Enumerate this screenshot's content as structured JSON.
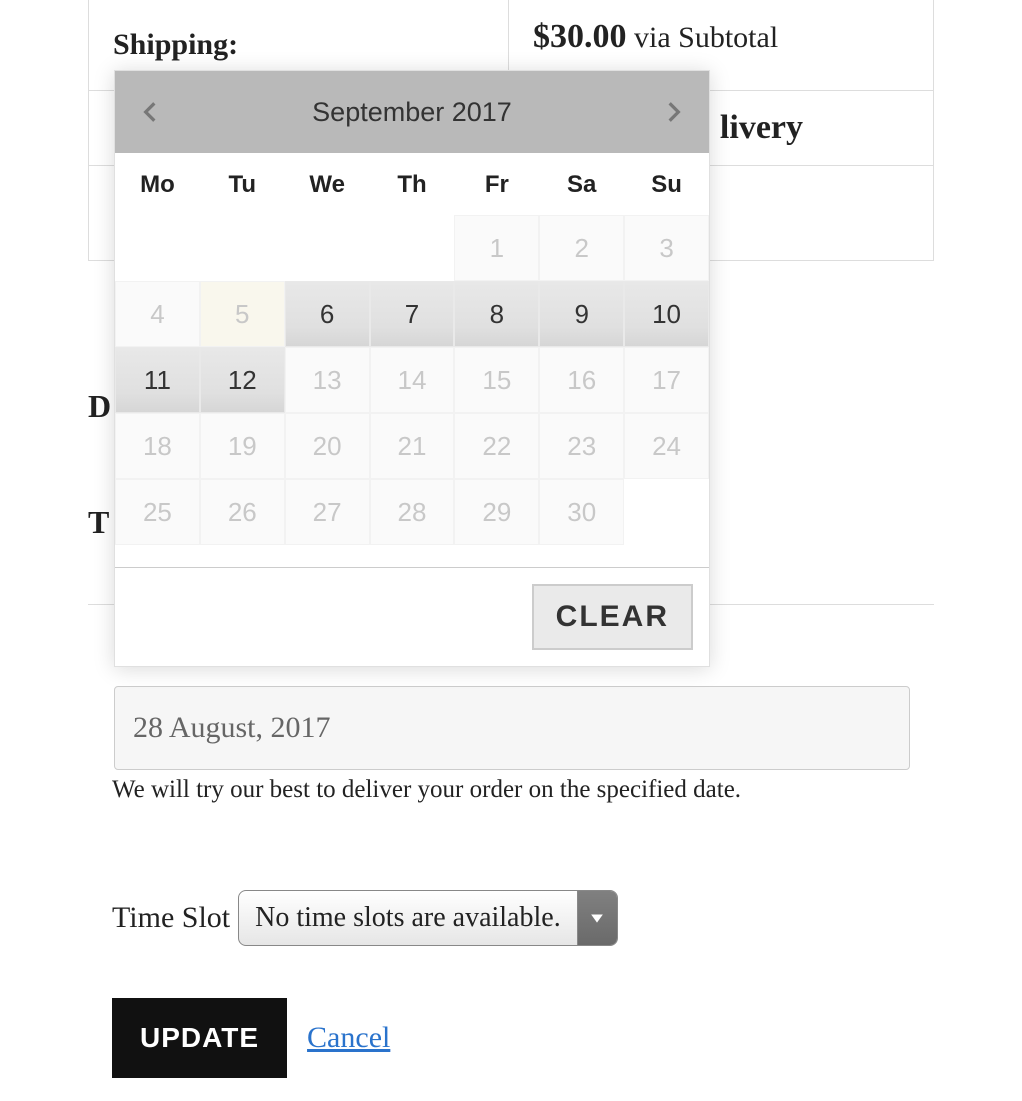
{
  "background": {
    "shipping_label": "Shipping:",
    "price": "$30.00",
    "via": "via Subtotal",
    "right2": "livery",
    "d_label": "D",
    "t_label": "T"
  },
  "datepicker": {
    "title": "September 2017",
    "weekdays": [
      "Mo",
      "Tu",
      "We",
      "Th",
      "Fr",
      "Sa",
      "Su"
    ],
    "weeks": [
      [
        {
          "d": "",
          "e": false
        },
        {
          "d": "",
          "e": false
        },
        {
          "d": "",
          "e": false
        },
        {
          "d": "",
          "e": false
        },
        {
          "d": "1",
          "e": false
        },
        {
          "d": "2",
          "e": false
        },
        {
          "d": "3",
          "e": false
        }
      ],
      [
        {
          "d": "4",
          "e": false
        },
        {
          "d": "5",
          "e": false,
          "hl": true
        },
        {
          "d": "6",
          "e": true
        },
        {
          "d": "7",
          "e": true
        },
        {
          "d": "8",
          "e": true
        },
        {
          "d": "9",
          "e": true
        },
        {
          "d": "10",
          "e": true
        }
      ],
      [
        {
          "d": "11",
          "e": true
        },
        {
          "d": "12",
          "e": true
        },
        {
          "d": "13",
          "e": false
        },
        {
          "d": "14",
          "e": false
        },
        {
          "d": "15",
          "e": false
        },
        {
          "d": "16",
          "e": false
        },
        {
          "d": "17",
          "e": false
        }
      ],
      [
        {
          "d": "18",
          "e": false
        },
        {
          "d": "19",
          "e": false
        },
        {
          "d": "20",
          "e": false
        },
        {
          "d": "21",
          "e": false
        },
        {
          "d": "22",
          "e": false
        },
        {
          "d": "23",
          "e": false
        },
        {
          "d": "24",
          "e": false
        }
      ],
      [
        {
          "d": "25",
          "e": false
        },
        {
          "d": "26",
          "e": false
        },
        {
          "d": "27",
          "e": false
        },
        {
          "d": "28",
          "e": false
        },
        {
          "d": "29",
          "e": false
        },
        {
          "d": "30",
          "e": false
        },
        {
          "d": "",
          "e": false
        }
      ]
    ],
    "clear_label": "CLEAR"
  },
  "form": {
    "date_value": "28 August, 2017",
    "help_text": "We will try our best to deliver your order on the specified date.",
    "timeslot_label": "Time Slot",
    "timeslot_selected": "No time slots are available.",
    "update_label": "UPDATE",
    "cancel_label": "Cancel"
  }
}
